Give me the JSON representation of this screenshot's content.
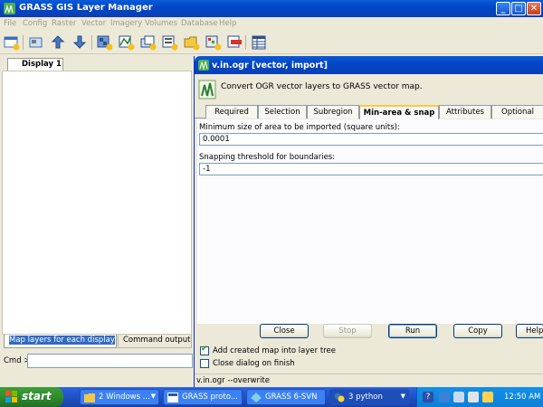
{
  "window": {
    "title": "GRASS GIS Layer Manager",
    "controls": {
      "minimize": "_",
      "maximize": "□",
      "close": "✕"
    }
  },
  "menu": [
    "File",
    "Config",
    "Raster",
    "Vector",
    "Imagery",
    "Volumes",
    "Database",
    "Help"
  ],
  "left": {
    "display_tab": "Display 1",
    "bottom_tabs": [
      "Map layers for each display",
      "Command output"
    ],
    "cmd_label": "Cmd >",
    "cmd_value": ""
  },
  "dialog": {
    "title": "v.in.ogr [vector, import]",
    "description": "Convert OGR vector layers to GRASS vector map.",
    "tabs": [
      "Required",
      "Selection",
      "Subregion",
      "Min-area & snap",
      "Attributes",
      "Optional"
    ],
    "active_tab": "Min-area & snap",
    "fields": [
      {
        "label": "Minimum size of area to be imported (square units):",
        "value": "0.0001"
      },
      {
        "label": "Snapping threshold for boundaries:",
        "value": "-1"
      }
    ],
    "buttons": {
      "close": "Close",
      "stop": "Stop",
      "run": "Run",
      "copy": "Copy",
      "help": "Help"
    },
    "checkboxes": [
      {
        "label": "Add created map into layer tree",
        "checked": true
      },
      {
        "label": "Close dialog on finish",
        "checked": false
      }
    ],
    "status": "v.in.ogr --overwrite"
  },
  "taskbar": {
    "start": "start",
    "tasks": [
      "2 Windows ...",
      "GRASS proto...",
      "GRASS 6-SVN",
      "3 python"
    ],
    "clock": "12:50 AM"
  },
  "colors": {
    "titlebar": "#0a4fd0",
    "desktop": "#3a6ea5",
    "start_green": "#2f8b2d",
    "tab_highlight": "#ffc83c"
  }
}
